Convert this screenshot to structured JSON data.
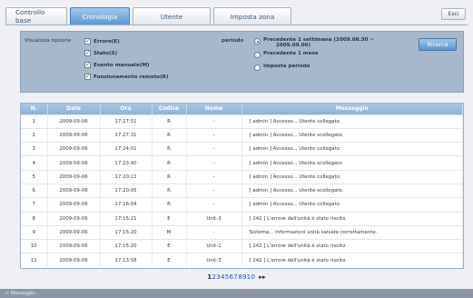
{
  "tabs": [
    {
      "label": "Controllo base",
      "active": false
    },
    {
      "label": "Cronologia",
      "active": true
    },
    {
      "label": "Utente",
      "active": false
    },
    {
      "label": "Imposta zona",
      "active": false
    }
  ],
  "esc_label": "Esci",
  "filter": {
    "view_option_label": "Visualizza opzione",
    "checkboxes": [
      {
        "label": "Errore(E)",
        "checked": true
      },
      {
        "label": "Stato(S)",
        "checked": true
      },
      {
        "label": "Evento manuale(M)",
        "checked": true
      },
      {
        "label": "Funzionamento remoto(R)",
        "checked": true
      }
    ],
    "period_label": "periodo",
    "radios": [
      {
        "label_line1": "Precedente 1 settimana (2009.08.30 ~",
        "label_line2": "2009.09.06)",
        "selected": true
      },
      {
        "label_line1": "Precedente 1 mese",
        "label_line2": "",
        "selected": false
      },
      {
        "label_line1": "Imposta periodo",
        "label_line2": "",
        "selected": false
      }
    ],
    "search_label": "Ricerca"
  },
  "table": {
    "columns": [
      "N.",
      "Date",
      "Ora",
      "Codice",
      "Nome",
      "Messaggio"
    ],
    "rows": [
      [
        "1",
        "2009-09-06",
        "17:27:51",
        "R",
        "-",
        "[ admin ] Accesso... Utente collegato."
      ],
      [
        "2",
        "2009-09-06",
        "17:27:31",
        "R",
        "-",
        "[ admin ] Accesso... Utente scollegato."
      ],
      [
        "3",
        "2009-09-06",
        "17:24:01",
        "R",
        "-",
        "[ admin ] Accesso... Utente collegato."
      ],
      [
        "4",
        "2009-09-06",
        "17:23:40",
        "R",
        "-",
        "[ admin ] Accesso... Utente scollegato."
      ],
      [
        "5",
        "2009-09-06",
        "17:20:22",
        "R",
        "-",
        "[ admin ] Accesso... Utente collegato."
      ],
      [
        "6",
        "2009-09-06",
        "17:20:05",
        "R",
        "-",
        "[ admin ] Accesso... Utente scollegato."
      ],
      [
        "7",
        "2009-09-06",
        "17:16:04",
        "R",
        "-",
        "[ admin ] Accesso... Utente collegato."
      ],
      [
        "8",
        "2009-09-06",
        "17:15:21",
        "E",
        "Unit-3",
        "[ 242 ] L'errore dell'unità è stato risolto."
      ],
      [
        "9",
        "2009-09-06",
        "17:15:20",
        "M",
        "-",
        "Sistema... Informazioni unità salvate correttamente."
      ],
      [
        "10",
        "2009-09-06",
        "17:15:20",
        "E",
        "Unit-1",
        "[ 242 ] L'errore dell'unità è stato risolto."
      ],
      [
        "11",
        "2009-09-06",
        "17:13:58",
        "E",
        "Unit-3",
        "[ 242 ] L'errore dell'unità è stato risolto."
      ]
    ]
  },
  "pager": {
    "pages": [
      "1",
      "2",
      "3",
      "4",
      "5",
      "6",
      "7",
      "8",
      "9",
      "10"
    ],
    "next": "▸▸"
  },
  "status_label": "< Messaggio:"
}
